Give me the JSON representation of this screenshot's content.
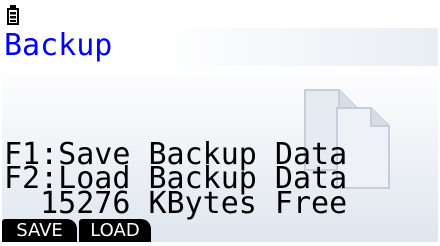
{
  "status_bar": {
    "icons": [
      "battery-icon"
    ]
  },
  "screen": {
    "title": "Backup",
    "background_icon": "document-copy-icon",
    "lines": [
      "F1:Save Backup Data",
      "F2:Load Backup Data",
      "  15276 KBytes Free"
    ]
  },
  "function_keys": [
    {
      "key": "F1",
      "label": "SAVE"
    },
    {
      "key": "F2",
      "label": "LOAD"
    }
  ],
  "colors": {
    "title": "#0000ff",
    "text": "#000000",
    "fkey_bg": "#000000",
    "fkey_text": "#ffffff"
  }
}
